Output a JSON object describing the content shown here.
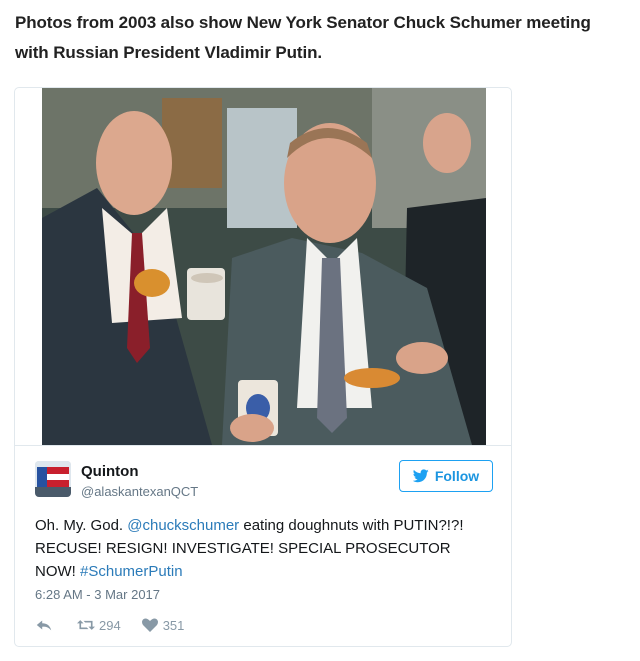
{
  "article": {
    "paragraph": "Photos from 2003 also show New York Senator Chuck Schumer meeting with Russian President Vladimir Putin."
  },
  "tweet": {
    "display_name": "Quinton",
    "screen_name": "@alaskantexanQCT",
    "follow_label": "Follow",
    "text_1": "Oh. My. God. ",
    "mention": "@chuckschumer",
    "text_2": " eating doughnuts with PUTIN?!?! RECUSE! RESIGN! INVESTIGATE! SPECIAL PROSECUTOR NOW! ",
    "hashtag": "#SchumerPutin",
    "timestamp": "6:28 AM - 3 Mar 2017",
    "retweets": "294",
    "likes": "351"
  },
  "icons": {
    "follow": "twitter-bird-icon",
    "reply": "reply-icon",
    "retweet": "retweet-icon",
    "like": "heart-icon"
  },
  "colors": {
    "twitter_blue": "#1da1f2",
    "link_blue": "#2b7bb9",
    "muted": "#657786",
    "action_gray": "#8899a6"
  }
}
